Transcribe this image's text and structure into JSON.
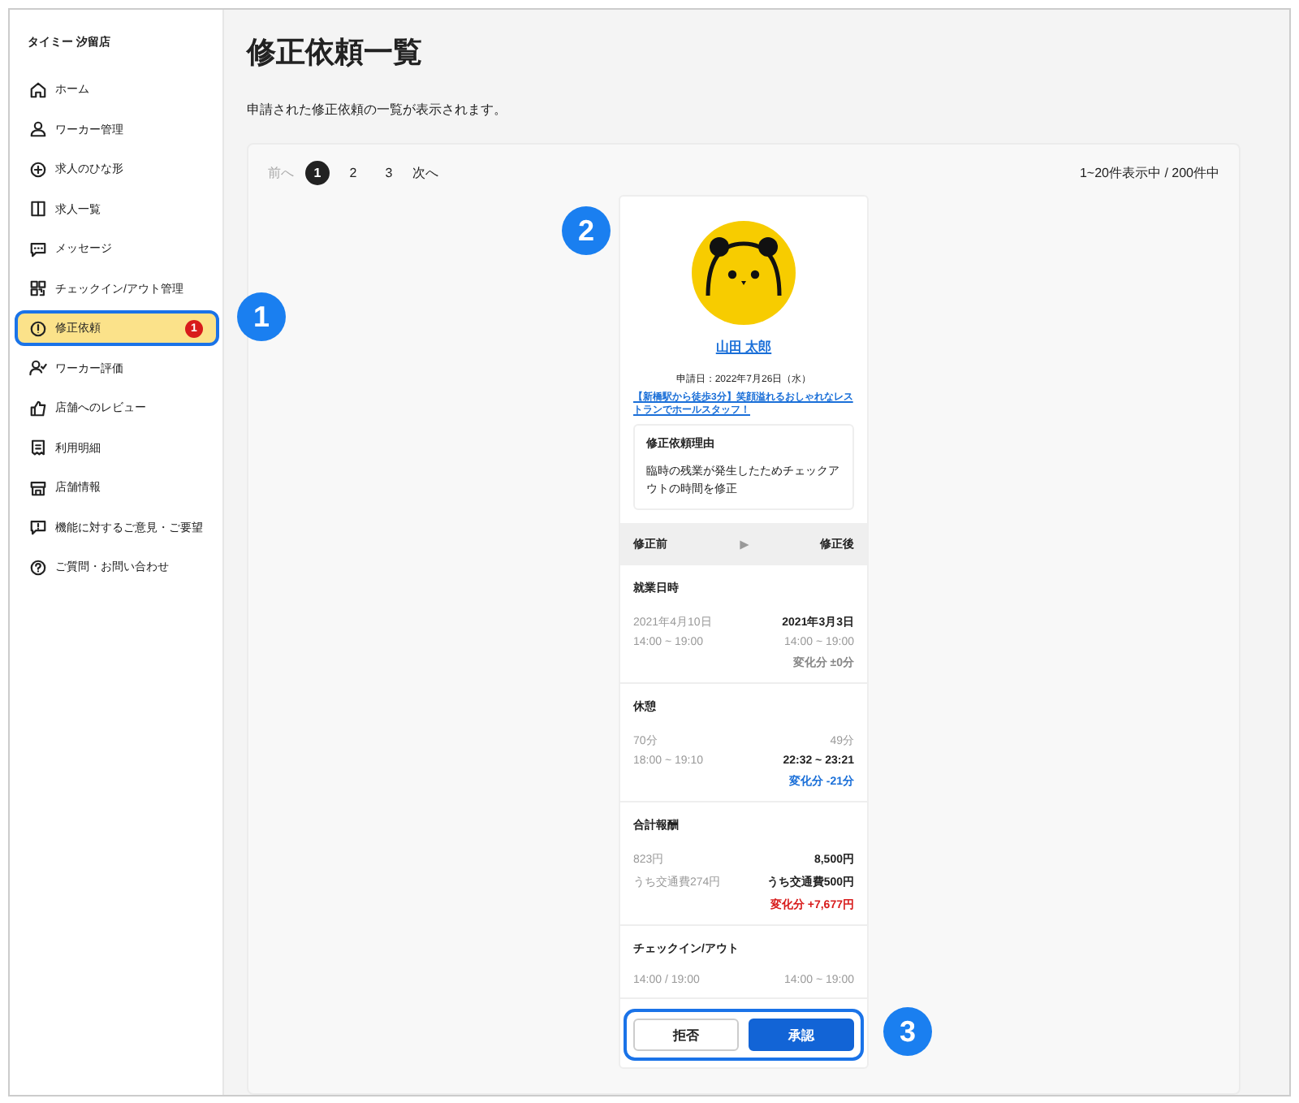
{
  "sidebar": {
    "store_name": "タイミー 汐留店",
    "items": [
      {
        "label": "ホーム",
        "selected": false
      },
      {
        "label": "ワーカー管理",
        "selected": false
      },
      {
        "label": "求人のひな形",
        "selected": false
      },
      {
        "label": "求人一覧",
        "selected": false
      },
      {
        "label": "メッセージ",
        "selected": false
      },
      {
        "label": "チェックイン/アウト管理",
        "selected": false
      },
      {
        "label": "修正依頼",
        "selected": true,
        "badge": "1"
      },
      {
        "label": "ワーカー評価",
        "selected": false
      },
      {
        "label": "店舗へのレビュー",
        "selected": false
      },
      {
        "label": "利用明細",
        "selected": false
      },
      {
        "label": "店舗情報",
        "selected": false
      },
      {
        "label": "機能に対するご意見・ご要望",
        "selected": false
      },
      {
        "label": "ご質問・お問い合わせ",
        "selected": false
      }
    ]
  },
  "page": {
    "title": "修正依頼一覧",
    "description": "申請された修正依頼の一覧が表示されます。"
  },
  "pagination": {
    "prev": "前へ",
    "pages": [
      {
        "label": "1",
        "selected": true
      },
      {
        "label": "2",
        "selected": false
      },
      {
        "label": "3",
        "selected": false
      }
    ],
    "next": "次へ",
    "summary": "1~20件表示中 / 200件中"
  },
  "request": {
    "worker_name": "山田 太郎",
    "applied_date": "申請日：2022年7月26日（水）",
    "job_link": "【新橋駅から徒歩3分】笑顔溢れるおしゃれなレストランでホールスタッフ！",
    "reason": {
      "title": "修正依頼理由",
      "text": "臨時の残業が発生したためチェックアウトの時間を修正"
    },
    "compare": {
      "before": "修正前",
      "after": "修正後"
    },
    "sections": [
      {
        "title": "就業日時",
        "before": [
          "2021年4月10日",
          "14:00 ~ 19:00"
        ],
        "after": [
          {
            "text": "2021年3月3日",
            "bold": true
          },
          {
            "text": "14:00 ~ 19:00",
            "bold": false
          }
        ],
        "change": {
          "text": "変化分 ±0分",
          "color": "#888888"
        }
      },
      {
        "title": "休憩",
        "before": [
          "70分",
          "18:00 ~ 19:10"
        ],
        "after": [
          {
            "text": "49分",
            "bold": false
          },
          {
            "text": "22:32 ~ 23:21",
            "bold": true
          }
        ],
        "change": {
          "text": "変化分 -21分",
          "color": "#1a6fd8"
        }
      },
      {
        "title": "合計報酬",
        "before": [
          "823円",
          "うち交通費274円"
        ],
        "after": [
          {
            "text": "8,500円",
            "bold": true
          },
          {
            "text": "うち交通費500円",
            "bold": true
          }
        ],
        "change": {
          "text": "変化分 +7,677円",
          "color": "#d81b1b"
        }
      },
      {
        "title": "チェックイン/アウト",
        "before": [
          "14:00 / 19:00"
        ],
        "after": [
          {
            "text": "14:00 ~ 19:00",
            "bold": false
          }
        ]
      }
    ],
    "buttons": {
      "reject": "拒否",
      "approve": "承認"
    }
  },
  "callouts": [
    "1",
    "2",
    "3"
  ]
}
